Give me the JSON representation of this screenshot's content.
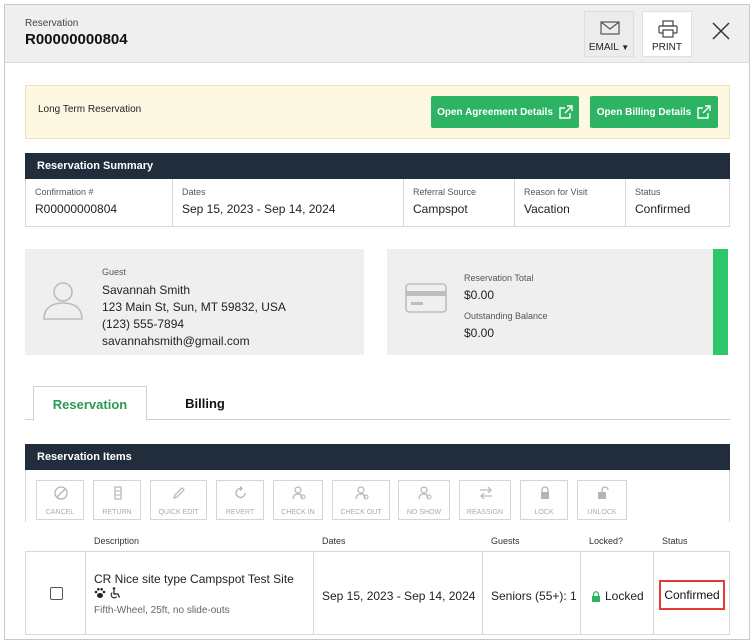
{
  "header": {
    "label": "Reservation",
    "id": "R00000000804",
    "email_label": "EMAIL",
    "print_label": "PRINT"
  },
  "notice": {
    "text": "Long Term Reservation",
    "agreement_button": "Open Agreement Details",
    "billing_button": "Open Billing Details"
  },
  "summary": {
    "title": "Reservation Summary",
    "fields": [
      {
        "label": "Confirmation #",
        "value": "R00000000804"
      },
      {
        "label": "Dates",
        "value": "Sep 15, 2023 - Sep 14, 2024"
      },
      {
        "label": "Referral Source",
        "value": "Campspot"
      },
      {
        "label": "Reason for Visit",
        "value": "Vacation"
      },
      {
        "label": "Status",
        "value": "Confirmed"
      }
    ]
  },
  "guest": {
    "label": "Guest",
    "name": "Savannah Smith",
    "address": "123 Main St, Sun, MT 59832, USA",
    "phone": "(123) 555-7894",
    "email": "savannahsmith@gmail.com"
  },
  "totals": {
    "total_label": "Reservation Total",
    "total_value": "$0.00",
    "balance_label": "Outstanding Balance",
    "balance_value": "$0.00",
    "accent_color": "#2ec769"
  },
  "tabs": [
    {
      "label": "Reservation",
      "active": true
    },
    {
      "label": "Billing",
      "active": false
    }
  ],
  "items": {
    "title": "Reservation Items",
    "toolbar": [
      {
        "label": "CANCEL",
        "icon": "cancel-icon"
      },
      {
        "label": "RETURN",
        "icon": "return-icon"
      },
      {
        "label": "QUICK EDIT",
        "icon": "pencil-icon"
      },
      {
        "label": "REVERT",
        "icon": "revert-icon"
      },
      {
        "label": "CHECK IN",
        "icon": "check-in-icon"
      },
      {
        "label": "CHECK OUT",
        "icon": "check-out-icon"
      },
      {
        "label": "NO SHOW",
        "icon": "no-show-icon"
      },
      {
        "label": "REASSIGN",
        "icon": "reassign-icon"
      },
      {
        "label": "LOCK",
        "icon": "lock-icon"
      },
      {
        "label": "UNLOCK",
        "icon": "unlock-icon"
      }
    ],
    "columns": [
      "Description",
      "Dates",
      "Guests",
      "Locked?",
      "Status"
    ],
    "row": {
      "site": "CR Nice site type Campspot Test Site",
      "details": "Fifth-Wheel, 25ft, no slide-outs",
      "dates": "Sep 15, 2023 - Sep 14, 2024",
      "guests": "Seniors (55+): 1",
      "locked": "Locked",
      "status": "Confirmed"
    }
  },
  "colors": {
    "primary_green": "#2cb463",
    "dark_bar": "#212d3b",
    "highlight_red": "#e53935"
  }
}
